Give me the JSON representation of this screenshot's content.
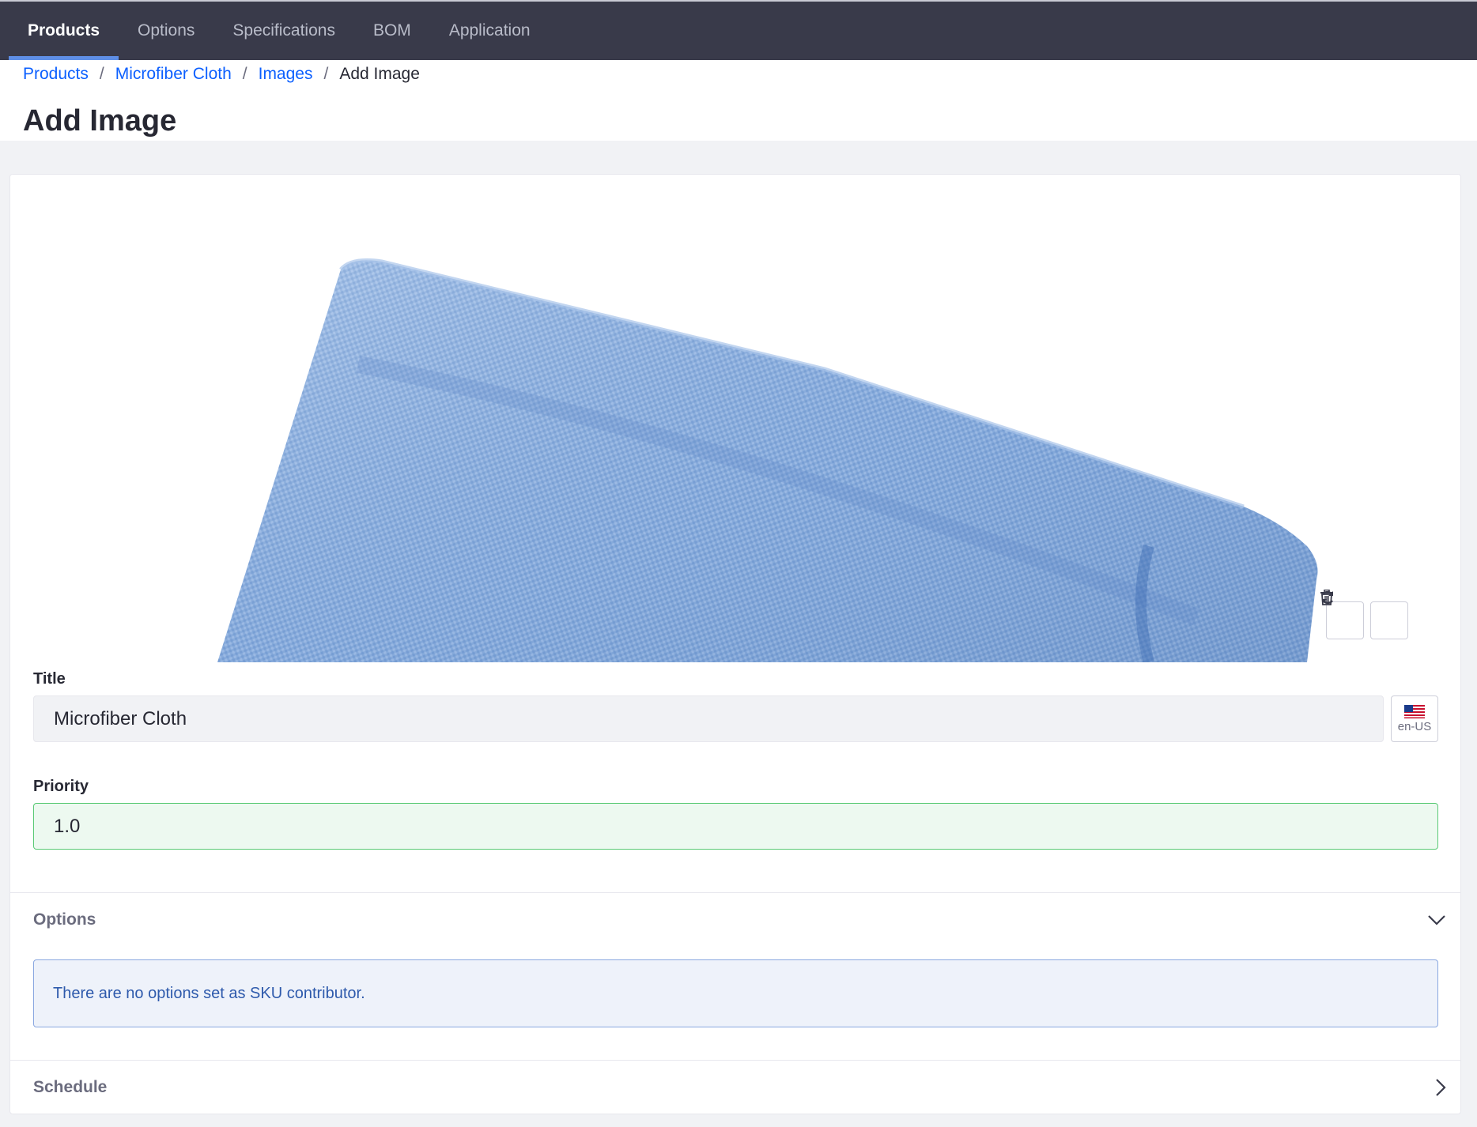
{
  "nav": {
    "tabs": [
      {
        "label": "Products",
        "active": true
      },
      {
        "label": "Options",
        "active": false
      },
      {
        "label": "Specifications",
        "active": false
      },
      {
        "label": "BOM",
        "active": false
      },
      {
        "label": "Application",
        "active": false
      }
    ]
  },
  "breadcrumb": {
    "items": [
      "Products",
      "Microfiber Cloth",
      "Images"
    ],
    "current": "Add Image",
    "separator": "/"
  },
  "page": {
    "title": "Add Image"
  },
  "image": {
    "subject": "blue microfiber cloth",
    "actions": {
      "change_icon": "refresh-icon",
      "delete_icon": "trash-icon"
    }
  },
  "form": {
    "title_label": "Title",
    "title_value": "Microfiber Cloth",
    "language": {
      "flag": "us-flag-icon",
      "code": "en-US"
    },
    "priority_label": "Priority",
    "priority_value": "1.0"
  },
  "panels": {
    "options": {
      "title": "Options",
      "expanded": true,
      "info_text": "There are no options set as SKU contributor."
    },
    "schedule": {
      "title": "Schedule",
      "expanded": false
    }
  },
  "colors": {
    "nav_bg": "#393a4a",
    "link": "#0b5fff",
    "success_border": "#5aca75",
    "info_text": "#2e5aac",
    "cloth": "#8fb2e0"
  }
}
